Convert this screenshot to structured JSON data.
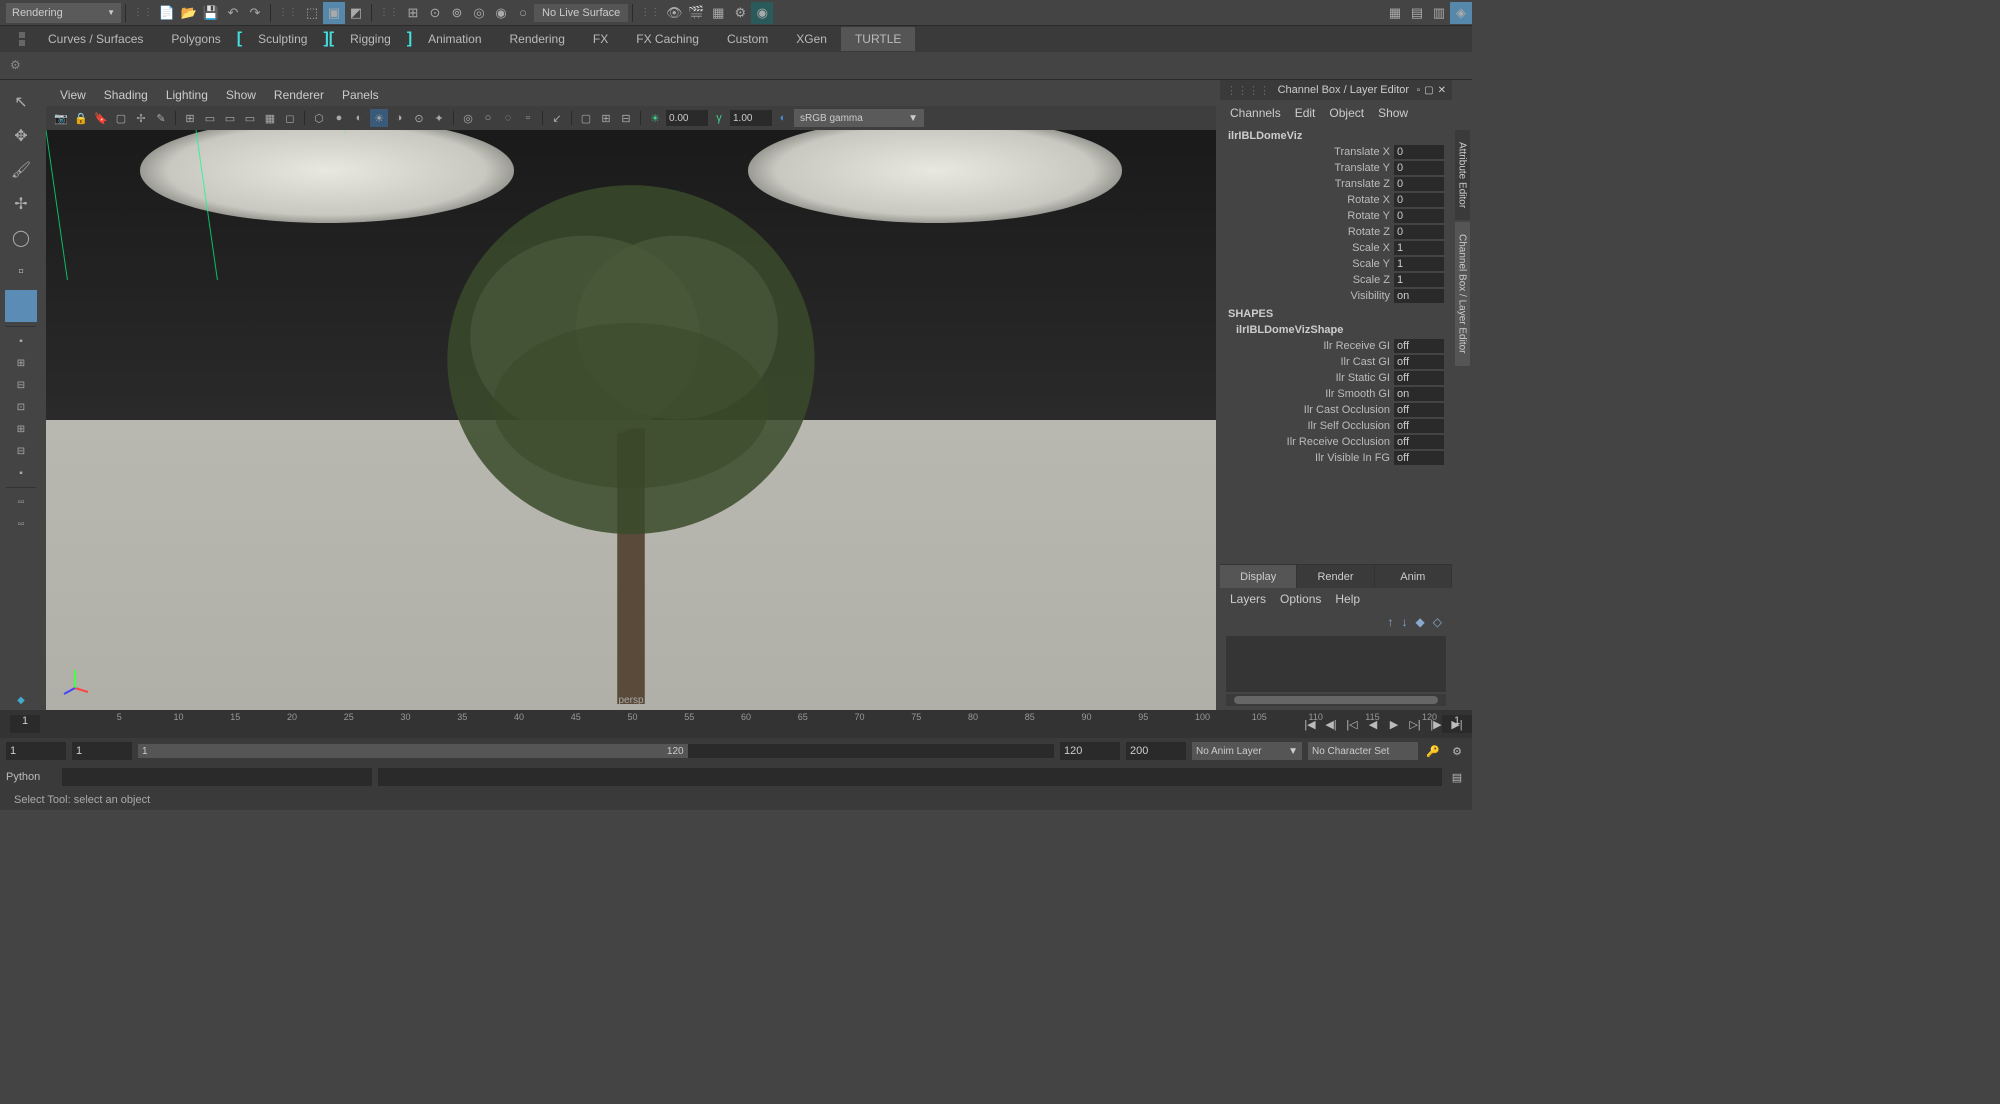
{
  "workspace": "Rendering",
  "no_live_surface": "No Live Surface",
  "shelf_tabs": [
    "Curves / Surfaces",
    "Polygons",
    "Sculpting",
    "Rigging",
    "Animation",
    "Rendering",
    "FX",
    "FX Caching",
    "Custom",
    "XGen",
    "TURTLE"
  ],
  "viewport_menu": [
    "View",
    "Shading",
    "Lighting",
    "Show",
    "Renderer",
    "Panels"
  ],
  "viewport_exposure": "0.00",
  "viewport_gamma": "1.00",
  "color_space": "sRGB gamma",
  "persp": "persp",
  "channel_box": {
    "title": "Channel Box / Layer Editor",
    "menu": [
      "Channels",
      "Edit",
      "Object",
      "Show"
    ],
    "object": "ilrIBLDomeViz",
    "transforms": [
      {
        "label": "Translate X",
        "value": "0"
      },
      {
        "label": "Translate Y",
        "value": "0"
      },
      {
        "label": "Translate Z",
        "value": "0"
      },
      {
        "label": "Rotate X",
        "value": "0"
      },
      {
        "label": "Rotate Y",
        "value": "0"
      },
      {
        "label": "Rotate Z",
        "value": "0"
      },
      {
        "label": "Scale X",
        "value": "1"
      },
      {
        "label": "Scale Y",
        "value": "1"
      },
      {
        "label": "Scale Z",
        "value": "1"
      },
      {
        "label": "Visibility",
        "value": "on"
      }
    ],
    "shapes_header": "SHAPES",
    "shape_name": "ilrIBLDomeVizShape",
    "shape_attrs": [
      {
        "label": "Ilr Receive GI",
        "value": "off"
      },
      {
        "label": "Ilr Cast GI",
        "value": "off"
      },
      {
        "label": "Ilr Static GI",
        "value": "off"
      },
      {
        "label": "Ilr Smooth GI",
        "value": "on"
      },
      {
        "label": "Ilr Cast Occlusion",
        "value": "off"
      },
      {
        "label": "Ilr Self Occlusion",
        "value": "off"
      },
      {
        "label": "Ilr Receive Occlusion",
        "value": "off"
      },
      {
        "label": "Ilr Visible In FG",
        "value": "off"
      }
    ]
  },
  "layer_tabs": [
    "Display",
    "Render",
    "Anim"
  ],
  "layer_menu": [
    "Layers",
    "Options",
    "Help"
  ],
  "sidebar_tabs": [
    "Attribute Editor",
    "Channel Box / Layer Editor"
  ],
  "timeline": {
    "start": "1",
    "end": "200",
    "range_start": "1",
    "range_end": "120",
    "current": "1",
    "anim_layer": "No Anim Layer",
    "character_set": "No Character Set"
  },
  "cmd_label": "Python",
  "help_text": "Select Tool: select an object"
}
